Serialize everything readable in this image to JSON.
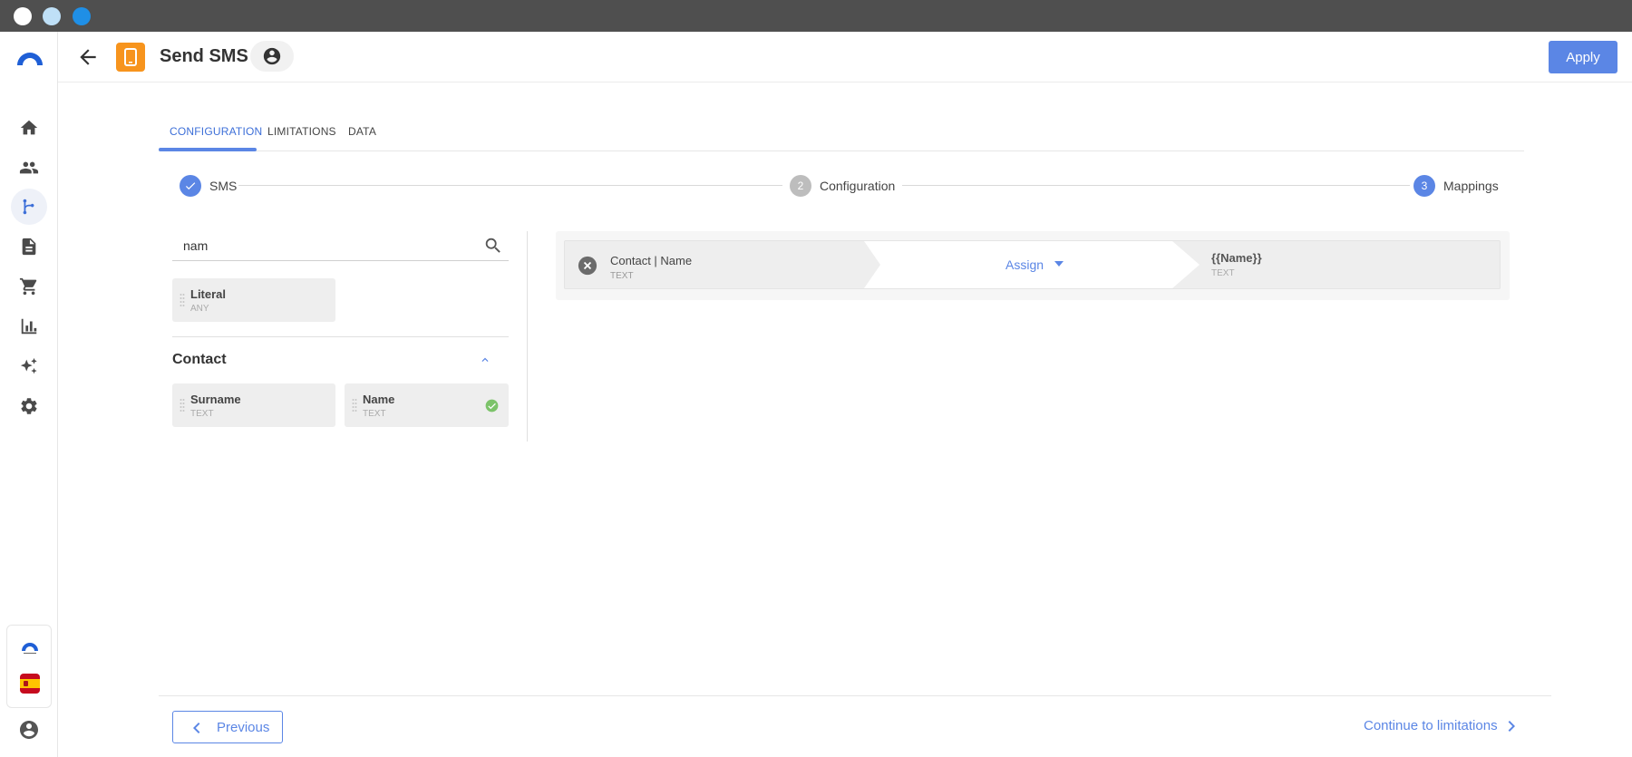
{
  "window": {
    "dots": [
      "close",
      "minimize",
      "maximize"
    ]
  },
  "sidebar": {
    "items": [
      {
        "icon": "home-icon"
      },
      {
        "icon": "people-icon"
      },
      {
        "icon": "workflow-icon",
        "active": true
      },
      {
        "icon": "document-icon"
      },
      {
        "icon": "cart-icon"
      },
      {
        "icon": "bar-chart-icon"
      },
      {
        "icon": "sparkles-icon"
      },
      {
        "icon": "gear-icon"
      }
    ],
    "bottom": [
      "brand-mini-logo",
      "spain-flag-icon",
      "account-icon"
    ]
  },
  "header": {
    "title": "Send SMS",
    "apply_label": "Apply"
  },
  "tabs": [
    {
      "label": "CONFIGURATION",
      "active": true
    },
    {
      "label": "LIMITATIONS"
    },
    {
      "label": "DATA"
    }
  ],
  "stepper": {
    "steps": [
      {
        "label": "SMS",
        "state": "done"
      },
      {
        "number": "2",
        "label": "Configuration",
        "state": "pending"
      },
      {
        "number": "3",
        "label": "Mappings",
        "state": "active"
      }
    ]
  },
  "fields": {
    "search_value": "nam",
    "literal": {
      "name": "Literal",
      "type": "ANY"
    },
    "group": {
      "title": "Contact",
      "items": [
        {
          "name": "Surname",
          "type": "TEXT",
          "mapped": false
        },
        {
          "name": "Name",
          "type": "TEXT",
          "mapped": true
        }
      ]
    }
  },
  "mapping": {
    "source_name": "Contact | Name",
    "source_type": "TEXT",
    "operation": "Assign",
    "target_name": "{{Name}}",
    "target_type": "TEXT"
  },
  "footer": {
    "previous_label": "Previous",
    "continue_label": "Continue to limitations"
  },
  "colors": {
    "accent": "#5b86e5",
    "app_icon": "#f7941d",
    "success": "#7cc36a"
  }
}
